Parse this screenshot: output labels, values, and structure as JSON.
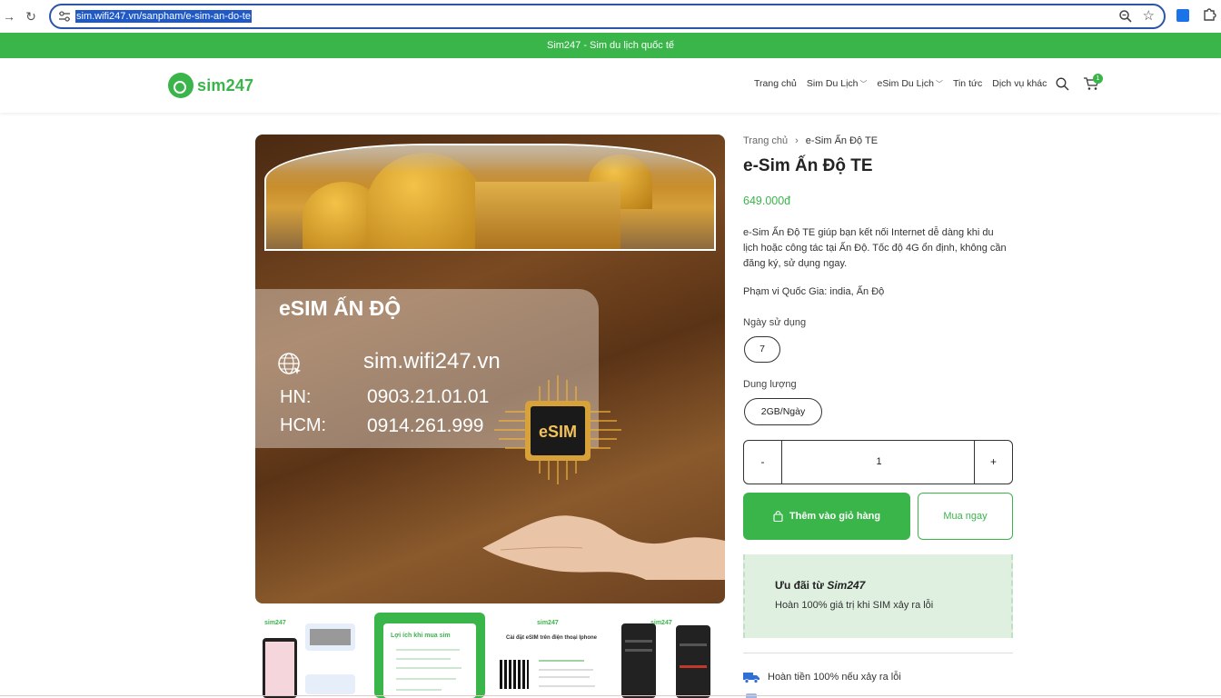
{
  "browser": {
    "url": "sim.wifi247.vn/sanpham/e-sim-an-do-te",
    "back_icon": "arrow-right-icon",
    "reload_icon": "reload-icon"
  },
  "announce": {
    "text": "Sim247 - Sim du lịch quốc tế"
  },
  "header": {
    "logo_text": "sim247",
    "nav": [
      {
        "label": "Trang chủ",
        "has_caret": false
      },
      {
        "label": "Sim Du Lịch",
        "has_caret": true
      },
      {
        "label": "eSim Du Lịch",
        "has_caret": true
      },
      {
        "label": "Tin tức",
        "has_caret": false
      },
      {
        "label": "Dịch vụ khác",
        "has_caret": false
      }
    ],
    "cart_count": "1"
  },
  "hero": {
    "card_title": "eSIM ẤN ĐỘ",
    "website": "sim.wifi247.vn",
    "hn_label": "HN:",
    "hn_phone": "0903.21.01.01",
    "hcm_label": "HCM:",
    "hcm_phone": "0914.261.999",
    "chip_text": "eSIM"
  },
  "thumbnails": {
    "t1_logo": "sim247",
    "t2_title": "Lợi ích khi mua sim",
    "t3_logo": "sim247",
    "t3_title": "Cài đặt eSIM trên điện thoại Iphone",
    "t4_logo": "sim247"
  },
  "product": {
    "breadcrumb": {
      "home": "Trang chủ",
      "current": "e-Sim Ấn Độ TE"
    },
    "title": "e-Sim Ấn Độ TE",
    "price": "649.000đ",
    "description": "e-Sim Ấn Độ TE giúp bạn kết nối Internet dễ dàng khi du lịch hoặc công tác tại Ấn Độ. Tốc độ 4G ổn định, không cần đăng ký, sử dụng ngay.",
    "scope": "Phạm vi Quốc Gia: india, Ấn Độ",
    "days_label": "Ngày sử dụng",
    "days_value": "7",
    "data_label": "Dung lượng",
    "data_value": "2GB/Ngày",
    "qty_minus": "-",
    "qty_value": "1",
    "qty_plus": "+",
    "add_to_cart": "Thêm vào giỏ hàng",
    "buy_now": "Mua ngay"
  },
  "promo": {
    "title_prefix": "Ưu đãi từ ",
    "title_brand": "Sim247",
    "text": "Hoàn 100% giá trị khi SIM xảy ra lỗi"
  },
  "benefits": [
    {
      "icon": "truck-icon",
      "text": "Hoàn tiền 100% nếu xảy ra lỗi"
    }
  ],
  "colors": {
    "brand_green": "#3ab54a",
    "promo_bg": "#dff0e1",
    "url_highlight": "#1f58c7"
  }
}
